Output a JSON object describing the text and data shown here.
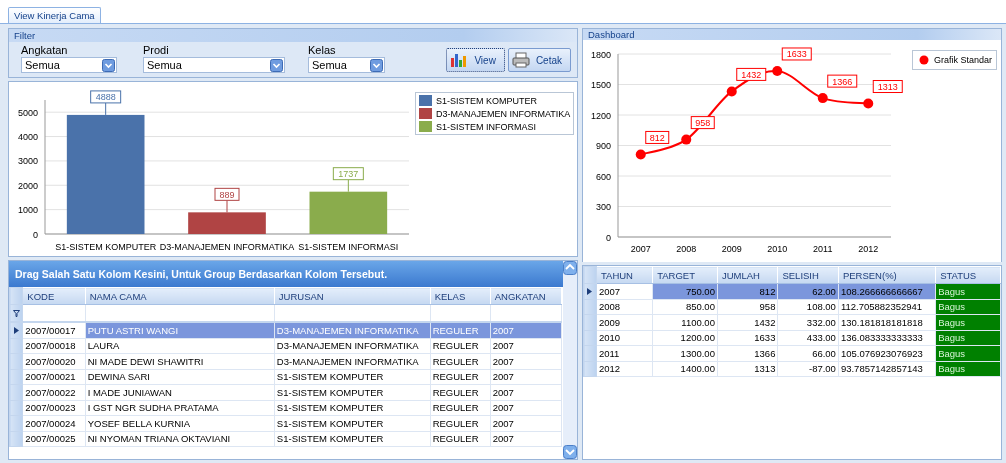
{
  "tab": {
    "label": "View Kinerja Cama",
    "selected": true
  },
  "filter": {
    "title": "Filter",
    "fields": [
      {
        "label": "Angkatan",
        "value": "Semua"
      },
      {
        "label": "Prodi",
        "value": "Semua"
      },
      {
        "label": "Kelas",
        "value": "Semua"
      }
    ],
    "buttons": [
      {
        "kind": "view",
        "label": "View"
      },
      {
        "kind": "print",
        "label": "Cetak"
      }
    ]
  },
  "bar_chart": {
    "chart_data": {
      "type": "bar",
      "categories": [
        "S1-SISTEM KOMPUTER",
        "D3-MANAJEMEN INFORMATIKA",
        "S1-SISTEM INFORMASI"
      ],
      "ylim": [
        0,
        5500
      ],
      "yticks": [
        0,
        1000,
        2000,
        3000,
        4000,
        5000
      ],
      "data_labels": true,
      "grid": true,
      "series": [
        {
          "name": "S1-SISTEM KOMPUTER",
          "color": "#4a72aa",
          "values": [
            4888,
            null,
            null
          ]
        },
        {
          "name": "D3-MANAJEMEN INFORMATIKA",
          "color": "#b04444",
          "values": [
            null,
            889,
            null
          ]
        },
        {
          "name": "S1-SISTEM INFORMASI",
          "color": "#8aac4c",
          "values": [
            null,
            null,
            1737
          ]
        }
      ]
    }
  },
  "students": {
    "group_hint": "Drag Salah Satu Kolom Kesini, Untuk Group Berdasarkan Kolom Tersebut.",
    "columns": [
      "KODE",
      "NAMA CAMA",
      "JURUSAN",
      "KELAS",
      "ANGKATAN"
    ],
    "rows": [
      {
        "selected": true,
        "cells": [
          "2007/00017",
          "PUTU ASTRI WANGI",
          "D3-MANAJEMEN INFORMATIKA",
          "REGULER",
          "2007"
        ]
      },
      {
        "selected": false,
        "cells": [
          "2007/00018",
          "LAURA",
          "D3-MANAJEMEN INFORMATIKA",
          "REGULER",
          "2007"
        ]
      },
      {
        "selected": false,
        "cells": [
          "2007/00020",
          "NI MADE DEWI SHAWITRI",
          "D3-MANAJEMEN INFORMATIKA",
          "REGULER",
          "2007"
        ]
      },
      {
        "selected": false,
        "cells": [
          "2007/00021",
          "DEWINA SARI",
          "S1-SISTEM KOMPUTER",
          "REGULER",
          "2007"
        ]
      },
      {
        "selected": false,
        "cells": [
          "2007/00022",
          "I MADE JUNIAWAN",
          "S1-SISTEM KOMPUTER",
          "REGULER",
          "2007"
        ]
      },
      {
        "selected": false,
        "cells": [
          "2007/00023",
          "I GST NGR SUDHA PRATAMA",
          "S1-SISTEM KOMPUTER",
          "REGULER",
          "2007"
        ]
      },
      {
        "selected": false,
        "cells": [
          "2007/00024",
          "YOSEF BELLA KURNIA",
          "S1-SISTEM KOMPUTER",
          "REGULER",
          "2007"
        ]
      },
      {
        "selected": false,
        "cells": [
          "2007/00025",
          "NI NYOMAN TRIANA OKTAVIANI",
          "S1-SISTEM KOMPUTER",
          "REGULER",
          "2007"
        ]
      }
    ]
  },
  "dashboard": {
    "title": "Dashboard",
    "chart_data": {
      "type": "line",
      "x": [
        "2007",
        "2008",
        "2009",
        "2010",
        "2011",
        "2012"
      ],
      "ylim": [
        0,
        1800
      ],
      "yticks": [
        0,
        300,
        600,
        900,
        1200,
        1500,
        1800
      ],
      "data_labels": true,
      "grid": true,
      "series": [
        {
          "name": "Grafik Standar",
          "color": "#ff0000",
          "marker": "circle",
          "values": [
            812,
            958,
            1432,
            1633,
            1366,
            1313
          ]
        }
      ]
    }
  },
  "performance": {
    "columns": [
      "TAHUN",
      "TARGET",
      "JUMLAH",
      "SELISIH",
      "PERSEN(%)",
      "STATUS"
    ],
    "rows": [
      {
        "selected": true,
        "cells": [
          "2007",
          "750.00",
          "812",
          "62.00",
          "108.266666666667",
          "Bagus"
        ]
      },
      {
        "selected": false,
        "cells": [
          "2008",
          "850.00",
          "958",
          "108.00",
          "112.705882352941",
          "Bagus"
        ]
      },
      {
        "selected": false,
        "cells": [
          "2009",
          "1100.00",
          "1432",
          "332.00",
          "130.181818181818",
          "Bagus"
        ]
      },
      {
        "selected": false,
        "cells": [
          "2010",
          "1200.00",
          "1633",
          "433.00",
          "136.083333333333",
          "Bagus"
        ]
      },
      {
        "selected": false,
        "cells": [
          "2011",
          "1300.00",
          "1366",
          "66.00",
          "105.076923076923",
          "Bagus"
        ]
      },
      {
        "selected": false,
        "cells": [
          "2012",
          "1400.00",
          "1313",
          "-87.00",
          "93.7857142857143",
          "Bagus"
        ]
      }
    ]
  }
}
